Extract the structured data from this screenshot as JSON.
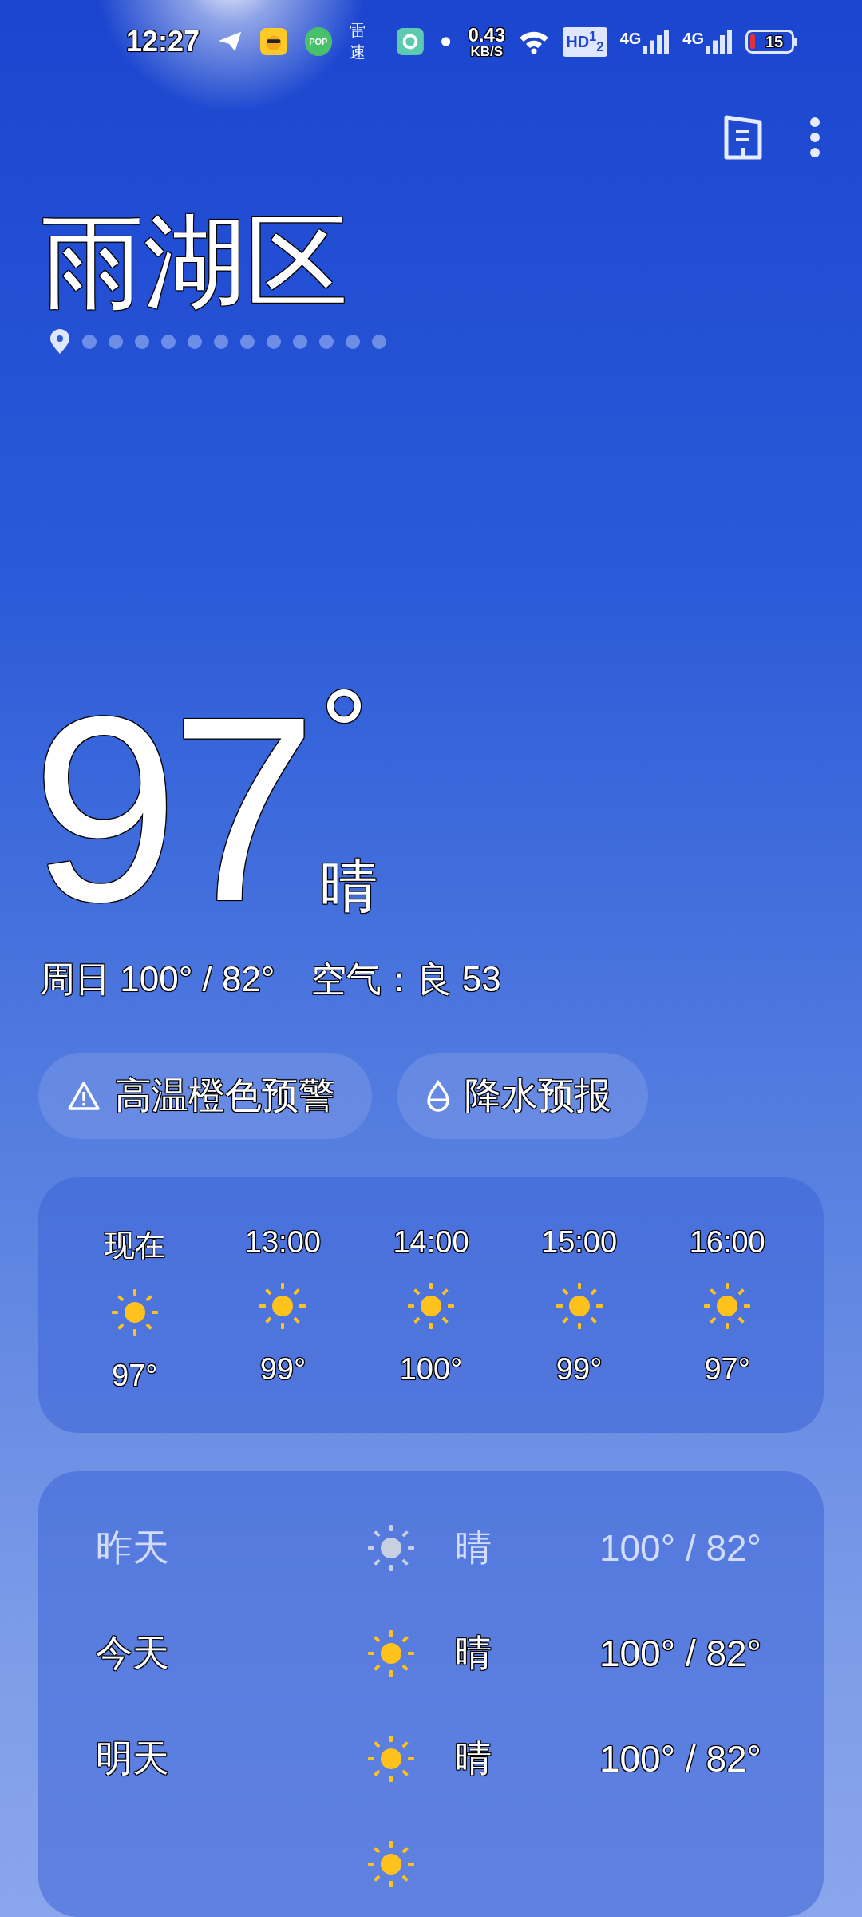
{
  "status_bar": {
    "time": "12:27",
    "notification_text": "雷速",
    "pop_label": "POP",
    "speed_value": "0.43",
    "speed_unit": "KB/S",
    "hd_label": "HD$^{1}$$_{2}$",
    "signals": [
      {
        "label": "4G"
      },
      {
        "label": "4G"
      }
    ],
    "battery": "15"
  },
  "city": {
    "name": "雨湖区",
    "pages": [
      {
        "kind": "location",
        "selected": true
      },
      {
        "kind": "dot",
        "selected": false
      },
      {
        "kind": "dot",
        "selected": false
      },
      {
        "kind": "dot",
        "selected": false
      },
      {
        "kind": "dot",
        "selected": false
      },
      {
        "kind": "dot",
        "selected": false
      },
      {
        "kind": "dot",
        "selected": false
      },
      {
        "kind": "dot",
        "selected": false
      },
      {
        "kind": "dot",
        "selected": false
      },
      {
        "kind": "dot",
        "selected": false
      },
      {
        "kind": "dot",
        "selected": false
      },
      {
        "kind": "dot",
        "selected": false
      },
      {
        "kind": "dot",
        "selected": false
      }
    ]
  },
  "current": {
    "temperature": "97",
    "degree": "°",
    "condition": "晴",
    "summary": "周日 100° / 82°",
    "air": "空气：良 53"
  },
  "chips": [
    {
      "kind": "warning",
      "label": "高温橙色预警"
    },
    {
      "kind": "rain",
      "label": "降水预报"
    }
  ],
  "hourly": [
    {
      "time": "现在",
      "temp": "97°"
    },
    {
      "time": "13:00",
      "temp": "99°"
    },
    {
      "time": "14:00",
      "temp": "100°"
    },
    {
      "time": "15:00",
      "temp": "99°"
    },
    {
      "time": "16:00",
      "temp": "97°"
    }
  ],
  "daily": [
    {
      "day": "昨天",
      "condition": "晴",
      "range": "100° / 82°",
      "dimmed": true
    },
    {
      "day": "今天",
      "condition": "晴",
      "range": "100° / 82°",
      "dimmed": false
    },
    {
      "day": "明天",
      "condition": "晴",
      "range": "100° / 82°",
      "dimmed": false
    },
    {
      "dimmed": false
    }
  ]
}
